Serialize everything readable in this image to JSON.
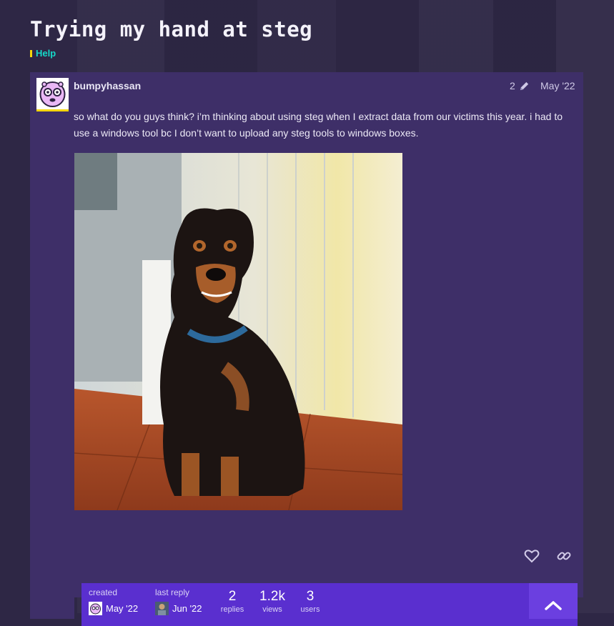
{
  "topic": {
    "title": "Trying my hand at steg",
    "category": "Help"
  },
  "post": {
    "author": "bumpyhassan",
    "edit_count": "2",
    "date": "May '22",
    "body": "so what do you guys think? i’m thinking about using steg when I extract data from our victims this year. i had to use a windows tool bc I don’t want to upload any steg tools to windows boxes.",
    "image_description_icon": "dog-photo"
  },
  "actions": {
    "like_icon": "heart-icon",
    "link_icon": "link-icon"
  },
  "topic_map": {
    "created_label": "created",
    "created_value": "May '22",
    "last_reply_label": "last reply",
    "last_reply_value": "Jun '22",
    "stats": [
      {
        "num": "2",
        "label": "replies"
      },
      {
        "num": "1.2k",
        "label": "views"
      },
      {
        "num": "3",
        "label": "users"
      }
    ]
  },
  "colors": {
    "category_accent": "#16d9c9",
    "category_swatch": "#f5d60a",
    "post_bg": "#3e2f68",
    "topic_map_bg": "#5a2fcf"
  }
}
